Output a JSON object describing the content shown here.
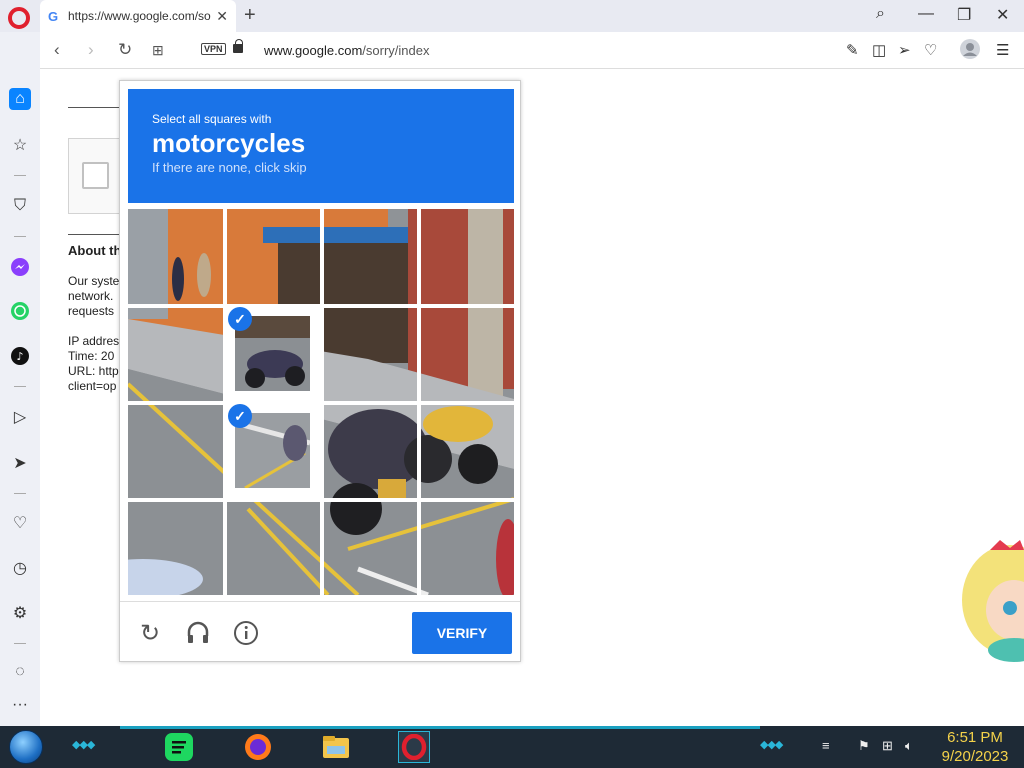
{
  "browser": {
    "tab_title": "https://www.google.com/so",
    "new_tab": "+",
    "url_domain": "www.google.com",
    "url_path": "/sorry/index",
    "vpn_label": "VPN"
  },
  "page": {
    "heading": "About th",
    "lines": [
      "Our syste",
      "network.",
      "requests",
      "IP addres",
      "Time: 20",
      "URL: http",
      "client=op"
    ]
  },
  "captcha": {
    "prompt": "Select all squares with",
    "object": "motorcycles",
    "skip_hint": "If there are none, click skip",
    "verify_label": "VERIFY",
    "tiles": [
      {
        "row": 0,
        "col": 0,
        "selected": false
      },
      {
        "row": 0,
        "col": 1,
        "selected": false
      },
      {
        "row": 0,
        "col": 2,
        "selected": false
      },
      {
        "row": 0,
        "col": 3,
        "selected": false
      },
      {
        "row": 1,
        "col": 0,
        "selected": false
      },
      {
        "row": 1,
        "col": 1,
        "selected": true
      },
      {
        "row": 1,
        "col": 2,
        "selected": false
      },
      {
        "row": 1,
        "col": 3,
        "selected": false
      },
      {
        "row": 2,
        "col": 0,
        "selected": false
      },
      {
        "row": 2,
        "col": 1,
        "selected": true
      },
      {
        "row": 2,
        "col": 2,
        "selected": false
      },
      {
        "row": 2,
        "col": 3,
        "selected": false
      },
      {
        "row": 3,
        "col": 0,
        "selected": false
      },
      {
        "row": 3,
        "col": 1,
        "selected": false
      },
      {
        "row": 3,
        "col": 2,
        "selected": false
      },
      {
        "row": 3,
        "col": 3,
        "selected": false
      }
    ],
    "footer_icons": [
      "reload-icon",
      "audio-icon",
      "info-icon"
    ]
  },
  "taskbar": {
    "time": "6:51 PM",
    "date": "9/20/2023",
    "apps": [
      "spotify-icon",
      "firefox-icon",
      "file-explorer-icon",
      "opera-icon"
    ]
  },
  "colors": {
    "accent": "#1a73e8",
    "opera_red": "#e0202e",
    "clock": "#f4d24a"
  }
}
